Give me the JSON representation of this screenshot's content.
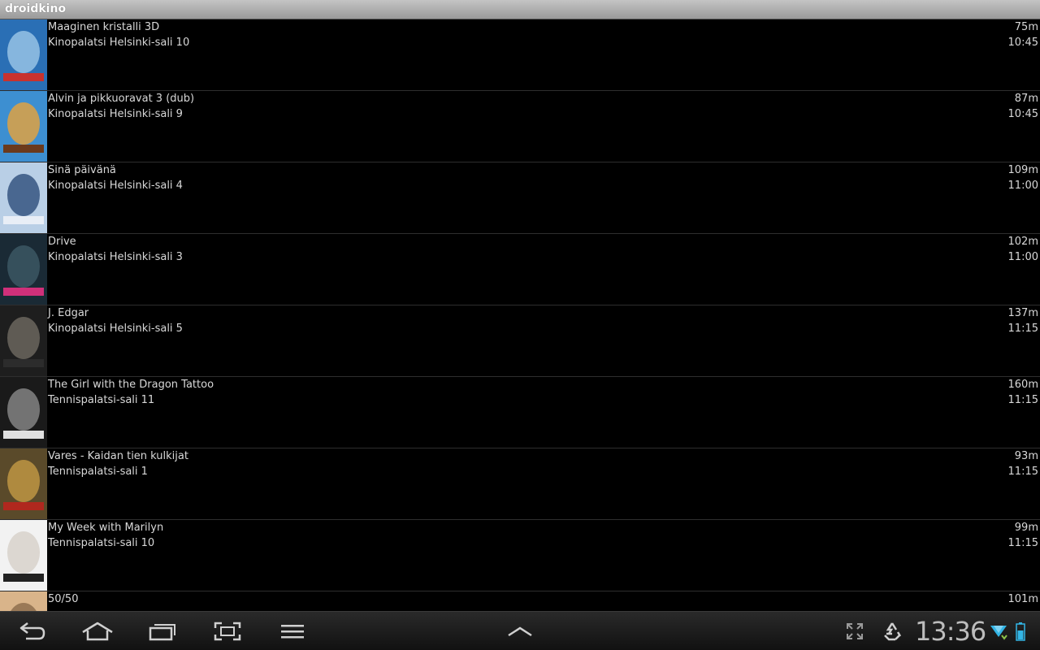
{
  "app": {
    "title": "droidkino"
  },
  "showings": [
    {
      "title": "Maaginen kristalli 3D",
      "venue": "Kinopalatsi Helsinki-sali 10",
      "duration": "75m",
      "time": "10:45",
      "poster_colors": [
        "#2a6fb5",
        "#9ec8e8",
        "#c8322e"
      ]
    },
    {
      "title": "Alvin ja pikkuoravat 3 (dub)",
      "venue": "Kinopalatsi Helsinki-sali 9",
      "duration": "87m",
      "time": "10:45",
      "poster_colors": [
        "#3d8fd1",
        "#e8a23a",
        "#6b3a1c"
      ]
    },
    {
      "title": "Sinä päivänä",
      "venue": "Kinopalatsi Helsinki-sali 4",
      "duration": "109m",
      "time": "11:00",
      "poster_colors": [
        "#b9cfe6",
        "#2d4c7a",
        "#e8eef6"
      ]
    },
    {
      "title": "Drive",
      "venue": "Kinopalatsi Helsinki-sali 3",
      "duration": "102m",
      "time": "11:00",
      "poster_colors": [
        "#1a2a35",
        "#3d5a66",
        "#d0307a"
      ]
    },
    {
      "title": "J. Edgar",
      "venue": "Kinopalatsi Helsinki-sali 5",
      "duration": "137m",
      "time": "11:15",
      "poster_colors": [
        "#1e1e1e",
        "#6f6a62",
        "#2c2c2c"
      ]
    },
    {
      "title": "The Girl with the Dragon Tattoo",
      "venue": "Tennispalatsi-sali 11",
      "duration": "160m",
      "time": "11:15",
      "poster_colors": [
        "#1a1a1a",
        "#8a8a8a",
        "#e0e0e0"
      ]
    },
    {
      "title": "Vares - Kaidan tien kulkijat",
      "venue": "Tennispalatsi-sali 1",
      "duration": "93m",
      "time": "11:15",
      "poster_colors": [
        "#5a4a2a",
        "#c49a45",
        "#b0281e"
      ]
    },
    {
      "title": "My Week with Marilyn",
      "venue": "Tennispalatsi-sali 10",
      "duration": "99m",
      "time": "11:15",
      "poster_colors": [
        "#f2f2f2",
        "#d6d0c8",
        "#222222"
      ]
    },
    {
      "title": "50/50",
      "venue": "",
      "duration": "101m",
      "time": "",
      "poster_colors": [
        "#d9b48a",
        "#8a6a4a",
        "#f0e0c8"
      ]
    }
  ],
  "navbar": {
    "back_icon": "back-arrow-icon",
    "home_icon": "home-icon",
    "recent_icon": "recent-apps-icon",
    "screenshot_icon": "screen-capture-icon",
    "menu_icon": "menu-icon",
    "up_icon": "chevron-up-icon",
    "expand_icon": "expand-icon",
    "recycle_icon": "recycle-icon",
    "wifi_icon": "wifi-icon",
    "battery_icon": "battery-icon",
    "clock": "13:36",
    "accent": "#33b5e5"
  }
}
